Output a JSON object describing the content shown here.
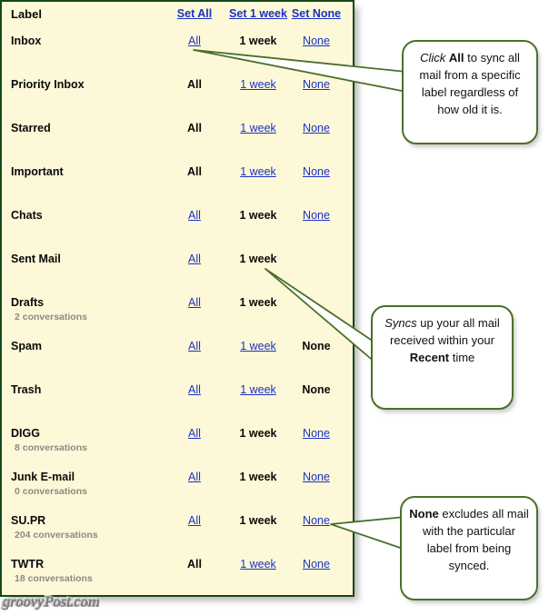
{
  "panel": {
    "columns": {
      "label_header": "Label",
      "set_all": "Set All",
      "set_week": "Set 1 week",
      "set_none": "Set None"
    },
    "rows": [
      {
        "label": "Inbox",
        "sub": "",
        "all": "All",
        "all_state": "link",
        "week": "1 week",
        "week_state": "selected",
        "none": "None",
        "none_state": "link"
      },
      {
        "label": "Priority Inbox",
        "sub": "",
        "all": "All",
        "all_state": "selected",
        "week": "1 week",
        "week_state": "link",
        "none": "None",
        "none_state": "link"
      },
      {
        "label": "Starred",
        "sub": "",
        "all": "All",
        "all_state": "selected",
        "week": "1 week",
        "week_state": "link",
        "none": "None",
        "none_state": "link"
      },
      {
        "label": "Important",
        "sub": "",
        "all": "All",
        "all_state": "selected",
        "week": "1 week",
        "week_state": "link",
        "none": "None",
        "none_state": "link"
      },
      {
        "label": "Chats",
        "sub": "",
        "all": "All",
        "all_state": "link",
        "week": "1 week",
        "week_state": "selected",
        "none": "None",
        "none_state": "link"
      },
      {
        "label": "Sent Mail",
        "sub": "",
        "all": "All",
        "all_state": "link",
        "week": "1 week",
        "week_state": "selected",
        "none": "",
        "none_state": "hidden"
      },
      {
        "label": "Drafts",
        "sub": "2 conversations",
        "all": "All",
        "all_state": "link",
        "week": "1 week",
        "week_state": "selected",
        "none": "",
        "none_state": "hidden"
      },
      {
        "label": "Spam",
        "sub": "",
        "all": "All",
        "all_state": "link",
        "week": "1 week",
        "week_state": "link",
        "none": "None",
        "none_state": "selected"
      },
      {
        "label": "Trash",
        "sub": "",
        "all": "All",
        "all_state": "link",
        "week": "1 week",
        "week_state": "link",
        "none": "None",
        "none_state": "selected"
      },
      {
        "label": "DIGG",
        "sub": "8 conversations",
        "all": "All",
        "all_state": "link",
        "week": "1 week",
        "week_state": "selected",
        "none": "None",
        "none_state": "link"
      },
      {
        "label": "Junk E-mail",
        "sub": "0 conversations",
        "all": "All",
        "all_state": "link",
        "week": "1 week",
        "week_state": "selected",
        "none": "None",
        "none_state": "link"
      },
      {
        "label": "SU.PR",
        "sub": "204 conversations",
        "all": "All",
        "all_state": "link",
        "week": "1 week",
        "week_state": "selected",
        "none": "None",
        "none_state": "link"
      },
      {
        "label": "TWTR",
        "sub": "18 conversations",
        "all": "All",
        "all_state": "selected",
        "week": "1 week",
        "week_state": "link",
        "none": "None",
        "none_state": "link"
      }
    ]
  },
  "callouts": [
    {
      "id": "callout-1",
      "segments": [
        {
          "text": "Click",
          "style": "italic"
        },
        {
          "text": " ",
          "style": "normal"
        },
        {
          "text": "All",
          "style": "bold"
        },
        {
          "text": " to sync all mail from a specific label regardless of how old it is.",
          "style": "normal"
        }
      ]
    },
    {
      "id": "callout-2",
      "segments": [
        {
          "text": "Syncs",
          "style": "italic"
        },
        {
          "text": " up your all mail received within your ",
          "style": "normal"
        },
        {
          "text": "Recent",
          "style": "bold"
        },
        {
          "text": " time",
          "style": "normal"
        }
      ]
    },
    {
      "id": "callout-3",
      "segments": [
        {
          "text": "None",
          "style": "bold"
        },
        {
          "text": " excludes all mail with the particular label from being synced.",
          "style": "normal"
        }
      ]
    }
  ],
  "watermark": {
    "text": "groovyPost.com"
  },
  "colors": {
    "panel_background": "#FDF8D8",
    "panel_border": "#16451a",
    "link": "#1b31c4",
    "selected_text": "#0a0a0a",
    "sub_text": "#8a8a84",
    "callout_border": "#4a7028",
    "callout_background": "#ffffff",
    "arrow_stroke": "#4a7028",
    "arrow_fill": "#ffffff"
  }
}
